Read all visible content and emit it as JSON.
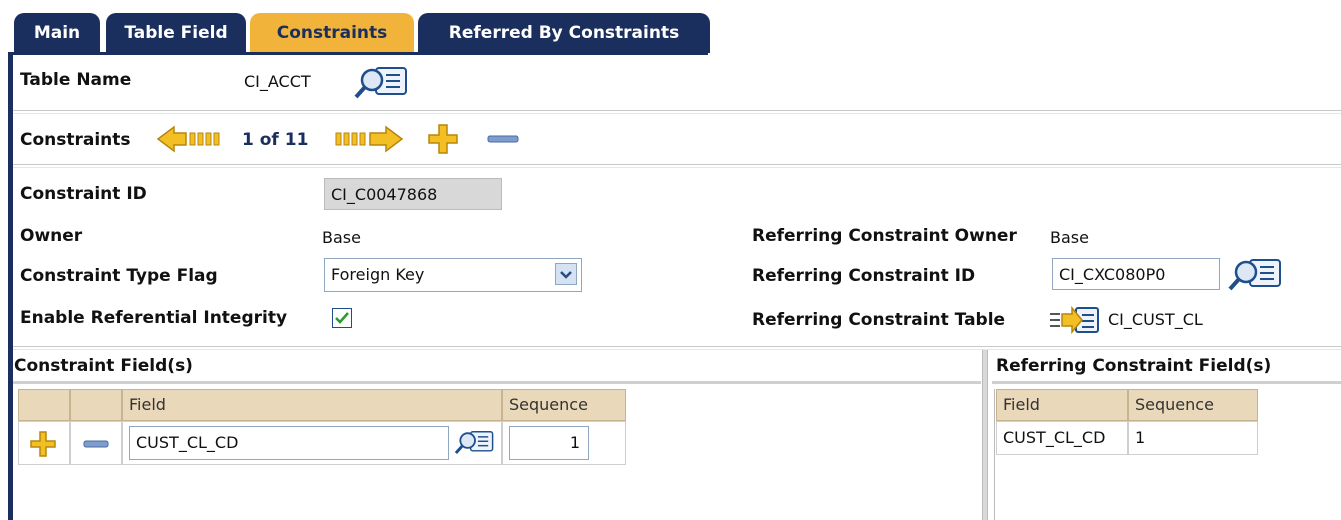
{
  "tabs": [
    {
      "label": "Main"
    },
    {
      "label": "Table Field"
    },
    {
      "label": "Constraints"
    },
    {
      "label": "Referred By Constraints"
    }
  ],
  "table": {
    "label": "Table Name",
    "value": "CI_ACCT"
  },
  "nav": {
    "label": "Constraints",
    "counter": "1 of 11"
  },
  "form": {
    "constraint_id": {
      "label": "Constraint ID",
      "value": "CI_C0047868"
    },
    "owner": {
      "label": "Owner",
      "value": "Base"
    },
    "type_flag": {
      "label": "Constraint Type Flag",
      "value": "Foreign Key"
    },
    "ref_integrity": {
      "label": "Enable Referential Integrity",
      "checked": true
    },
    "ref_owner": {
      "label": "Referring Constraint Owner",
      "value": "Base"
    },
    "ref_id": {
      "label": "Referring Constraint ID",
      "value": "CI_CXC080P0"
    },
    "ref_table": {
      "label": "Referring Constraint Table",
      "value": "CI_CUST_CL"
    }
  },
  "constraint_fields": {
    "title": "Constraint Field(s)",
    "columns": [
      "Field",
      "Sequence"
    ],
    "rows": [
      {
        "field": "CUST_CL_CD",
        "sequence": "1"
      }
    ]
  },
  "referring_fields": {
    "title": "Referring Constraint Field(s)",
    "columns": [
      "Field",
      "Sequence"
    ],
    "rows": [
      {
        "field": "CUST_CL_CD",
        "sequence": "1"
      }
    ]
  },
  "colors": {
    "navy": "#1b2f5e",
    "gold": "#f2b33b",
    "header_beige": "#e9d8b9"
  }
}
